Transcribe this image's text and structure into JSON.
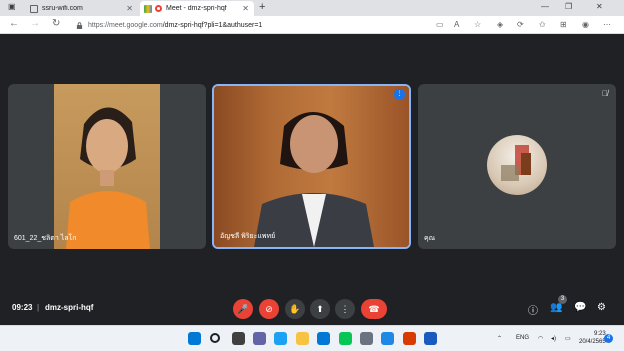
{
  "browser": {
    "tabs": [
      {
        "title": "ssru-wifi.com",
        "active": false
      },
      {
        "title": "Meet - dmz-spri-hqf",
        "active": true
      }
    ],
    "url_host": "https://meet.google.com",
    "url_path": "/dmz-spri-hqf?pli=1&authuser=1"
  },
  "meeting": {
    "time": "09:23",
    "separator": "|",
    "code": "dmz-spri-hqf",
    "participant_count": "3"
  },
  "participants": [
    {
      "name": "601_22_ชลิตา ไลโก",
      "speaking": false,
      "muted": false,
      "video": true
    },
    {
      "name": "อัญชลี พิริยะแพทย์",
      "speaking": true,
      "muted": false,
      "video": true
    },
    {
      "name": "คุณ",
      "speaking": false,
      "muted": true,
      "video": false
    }
  ],
  "controls": [
    {
      "id": "mic",
      "icon": "mic-off-icon",
      "state": "off"
    },
    {
      "id": "camera",
      "icon": "camera-off-icon",
      "state": "off"
    },
    {
      "id": "hand",
      "icon": "raise-hand-icon"
    },
    {
      "id": "present",
      "icon": "present-screen-icon"
    },
    {
      "id": "more",
      "icon": "more-options-icon"
    },
    {
      "id": "leave",
      "icon": "leave-call-icon"
    }
  ],
  "taskbar": {
    "language": "ENG",
    "time": "9:23",
    "date": "20/4/2565",
    "notifications": "4"
  },
  "colors": {
    "accent": "#1a73e8",
    "danger": "#ea4335",
    "stage": "#202124",
    "tile": "#3c4043"
  }
}
